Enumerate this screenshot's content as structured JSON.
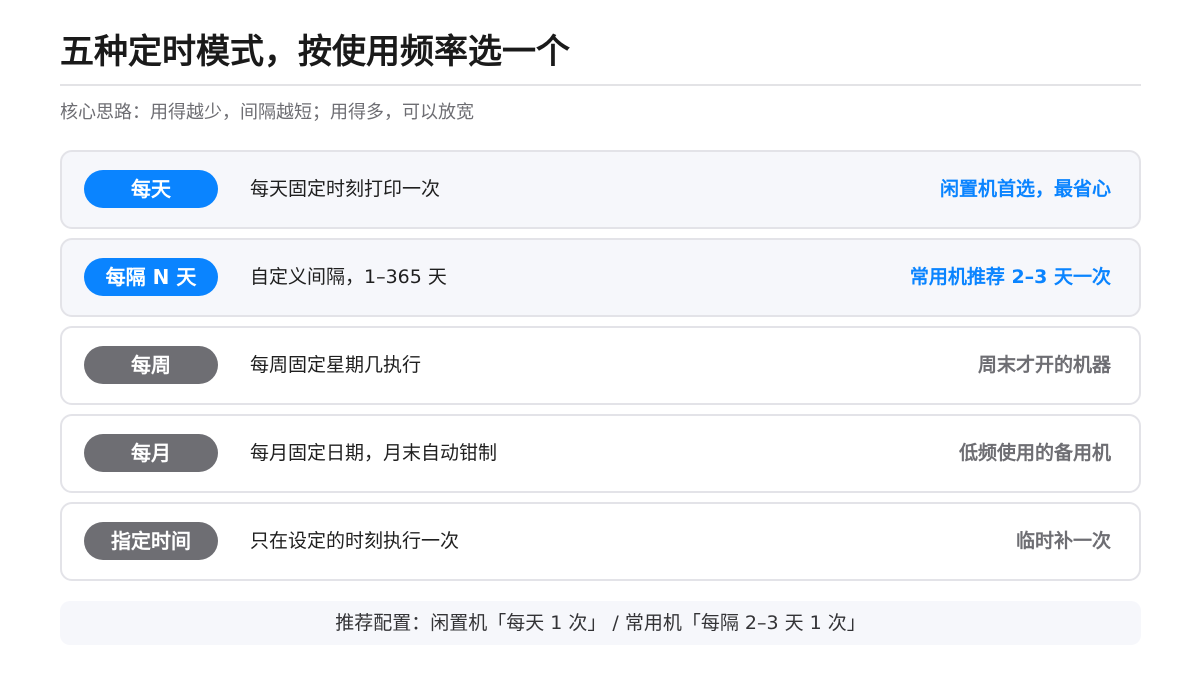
{
  "title": "五种定时模式，按使用频率选一个",
  "subtitle": "核心思路：用得越少，间隔越短；用得多，可以放宽",
  "accent_color": "#0a84ff",
  "muted_color": "#6e6e73",
  "modes": [
    {
      "label": "每天",
      "description": "每天固定时刻打印一次",
      "note": "闲置机首选，最省心",
      "style": "blue"
    },
    {
      "label": "每隔 N 天",
      "description": "自定义间隔，1–365 天",
      "note": "常用机推荐 2–3 天一次",
      "style": "blue"
    },
    {
      "label": "每周",
      "description": "每周固定星期几执行",
      "note": "周末才开的机器",
      "style": "gray"
    },
    {
      "label": "每月",
      "description": "每月固定日期，月末自动钳制",
      "note": "低频使用的备用机",
      "style": "gray"
    },
    {
      "label": "指定时间",
      "description": "只在设定的时刻执行一次",
      "note": "临时补一次",
      "style": "gray"
    }
  ],
  "footer": "推荐配置：闲置机「每天 1 次」 / 常用机「每隔 2–3 天 1 次」"
}
